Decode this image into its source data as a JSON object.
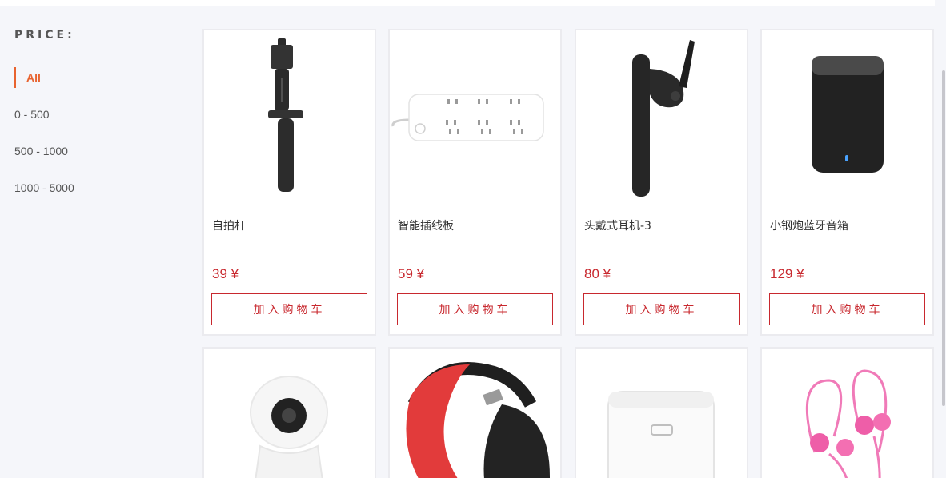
{
  "filter": {
    "title": "PRICE:",
    "items": [
      "All",
      "0 - 500",
      "500 - 1000",
      "1000 - 5000"
    ],
    "active_index": 0
  },
  "colors": {
    "accent": "#e8632f",
    "price": "#c8282e",
    "background": "#f5f6fa"
  },
  "products": [
    {
      "name": "自拍杆",
      "price": "39 ¥",
      "button": "加入购物车",
      "icon": "selfie-stick-icon"
    },
    {
      "name": "智能插线板",
      "price": "59 ¥",
      "button": "加入购物车",
      "icon": "power-strip-icon"
    },
    {
      "name": "头戴式耳机-3",
      "price": "80 ¥",
      "button": "加入购物车",
      "icon": "bluetooth-earpiece-icon"
    },
    {
      "name": "小钢炮蓝牙音箱",
      "price": "129 ¥",
      "button": "加入购物车",
      "icon": "bluetooth-speaker-icon"
    },
    {
      "name": "",
      "price": "",
      "button": "",
      "icon": "smart-camera-icon"
    },
    {
      "name": "",
      "price": "",
      "button": "",
      "icon": "headphones-icon"
    },
    {
      "name": "",
      "price": "",
      "button": "",
      "icon": "rice-cooker-icon"
    },
    {
      "name": "",
      "price": "",
      "button": "",
      "icon": "earphones-icon"
    }
  ]
}
